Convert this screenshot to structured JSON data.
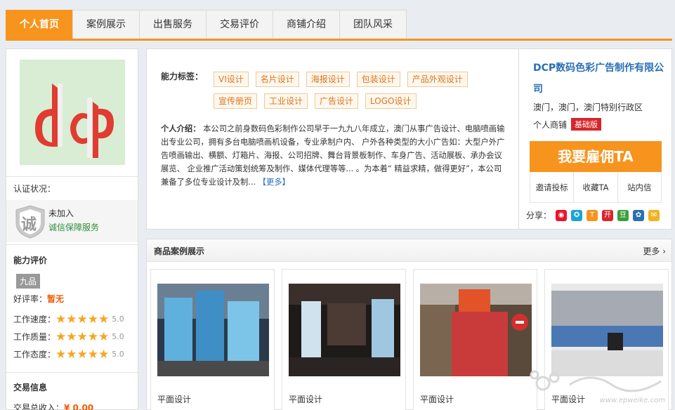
{
  "nav": {
    "tabs": [
      "个人首页",
      "案例展示",
      "出售服务",
      "交易评价",
      "商铺介绍",
      "团队风采"
    ],
    "active_index": 0
  },
  "left": {
    "cert_label": "认证状况：",
    "cert_status": "未加入",
    "cert_link": "诚信保障服务",
    "shield_char": "诚",
    "ability_title": "能力评价",
    "grade": "九品",
    "praise_label": "好评率：",
    "praise_value": "暂无",
    "ratings": [
      {
        "label": "工作速度：",
        "score": "5.0",
        "stars": 5
      },
      {
        "label": "工作质量：",
        "score": "5.0",
        "stars": 5
      },
      {
        "label": "工作态度：",
        "score": "5.0",
        "stars": 5
      }
    ],
    "trade_title": "交易信息",
    "income_label": "交易总收入：",
    "income_value": "¥ 0.00"
  },
  "info": {
    "ability_label": "能力标签：",
    "tags": [
      "VI设计",
      "名片设计",
      "海报设计",
      "包装设计",
      "产品外观设计",
      "宣传册页",
      "工业设计",
      "广告设计",
      "LOGO设计"
    ],
    "intro_label": "个人介绍：",
    "intro_text": "本公司之前身数码色彩制作公司早于一九九八年成立，澳门从事广告设计、电脑喷画输出专业公司，拥有多台电脑喷画机设备，专业承制户内、 户外各种类型的大小广告如：大型户外广告喷画输出、横额、灯箱片、海报、公司招牌、舞台背景板制作、车身广告、活动展板、承办会议展览、 企业推广活动策划统筹及制作、媒体代理等等... 。为本着“ 精益求精，做得更好”，本公司兼备了多位专业设计及制...",
    "more_link": "【更多】"
  },
  "company": {
    "name": "DCP数码色彩广告制作有限公司",
    "location": "澳门，澳门，澳门特别行政区",
    "shop_type": "个人商铺",
    "badge": "基础版",
    "hire_button": "我要雇佣TA",
    "actions": [
      "邀请投标",
      "收藏TA",
      "站内信"
    ],
    "share_label": "分享："
  },
  "products": {
    "title": "商品案例展示",
    "more": "更多",
    "items": [
      {
        "label": "平面设计"
      },
      {
        "label": "平面设计"
      },
      {
        "label": "平面设计"
      },
      {
        "label": "平面设计"
      }
    ]
  },
  "watermark": "www.epweike.com",
  "colors": {
    "accent": "#f7941d",
    "link": "#2a6fb5",
    "badge": "#d9252a",
    "price": "#f25a00"
  }
}
